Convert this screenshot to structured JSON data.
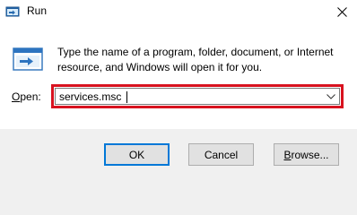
{
  "window": {
    "title": "Run",
    "close_icon": "close-icon"
  },
  "dialog": {
    "icon": "run-icon",
    "description": "Type the name of a program, folder, document, or Internet resource, and Windows will open it for you.",
    "open_label_underlined": "O",
    "open_label_rest": "pen:",
    "open_value": "services.msc",
    "highlight_color": "#d8121f"
  },
  "buttons": {
    "ok_label": "OK",
    "cancel_label": "Cancel",
    "browse_underlined": "B",
    "browse_rest": "rowse..."
  }
}
